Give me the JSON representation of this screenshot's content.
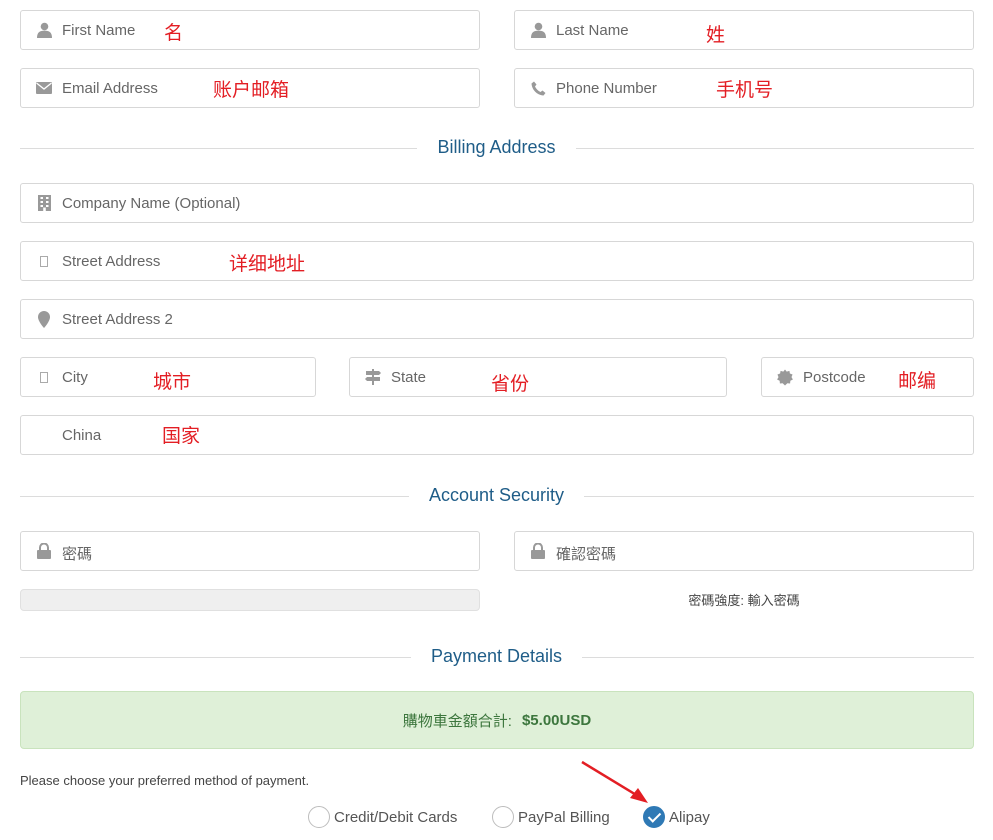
{
  "contact": {
    "first_name": {
      "placeholder": "First Name",
      "note": "名",
      "icon": "user-icon"
    },
    "last_name": {
      "placeholder": "Last Name",
      "note": "姓",
      "icon": "user-icon"
    },
    "email": {
      "placeholder": "Email Address",
      "note": "账户邮箱",
      "icon": "envelope-icon"
    },
    "phone": {
      "placeholder": "Phone Number",
      "note": "手机号",
      "icon": "phone-icon"
    }
  },
  "billing": {
    "title": "Billing Address",
    "company": {
      "placeholder": "Company Name (Optional)",
      "icon": "building-icon"
    },
    "street": {
      "placeholder": "Street Address",
      "note": "详细地址",
      "icon": "missing-glyph-icon"
    },
    "street2": {
      "placeholder": "Street Address 2",
      "icon": "map-marker-icon"
    },
    "city": {
      "placeholder": "City",
      "note": "城市",
      "icon": "missing-glyph-icon"
    },
    "state": {
      "placeholder": "State",
      "note": "省份",
      "icon": "signpost-icon"
    },
    "postcode": {
      "placeholder": "Postcode",
      "note": "邮编",
      "icon": "certificate-icon"
    },
    "country": {
      "value": "China",
      "note": "国家"
    }
  },
  "security": {
    "title": "Account Security",
    "password": {
      "placeholder": "密碼",
      "icon": "lock-icon"
    },
    "confirm": {
      "placeholder": "確認密碼",
      "icon": "lock-icon"
    },
    "strength_text": "密碼強度: 輸入密碼"
  },
  "payment": {
    "title": "Payment Details",
    "total_label": "購物車金額合計:",
    "total_value": "$5.00USD",
    "hint": "Please choose your preferred method of payment.",
    "options": [
      {
        "label": "Credit/Debit Cards",
        "checked": false
      },
      {
        "label": "PayPal Billing",
        "checked": false
      },
      {
        "label": "Alipay",
        "checked": true
      }
    ]
  },
  "colors": {
    "accent": "#1f5d88",
    "note_red": "#e31e24",
    "success_bg": "#dff0d8",
    "radio_checked": "#2f79b5"
  }
}
